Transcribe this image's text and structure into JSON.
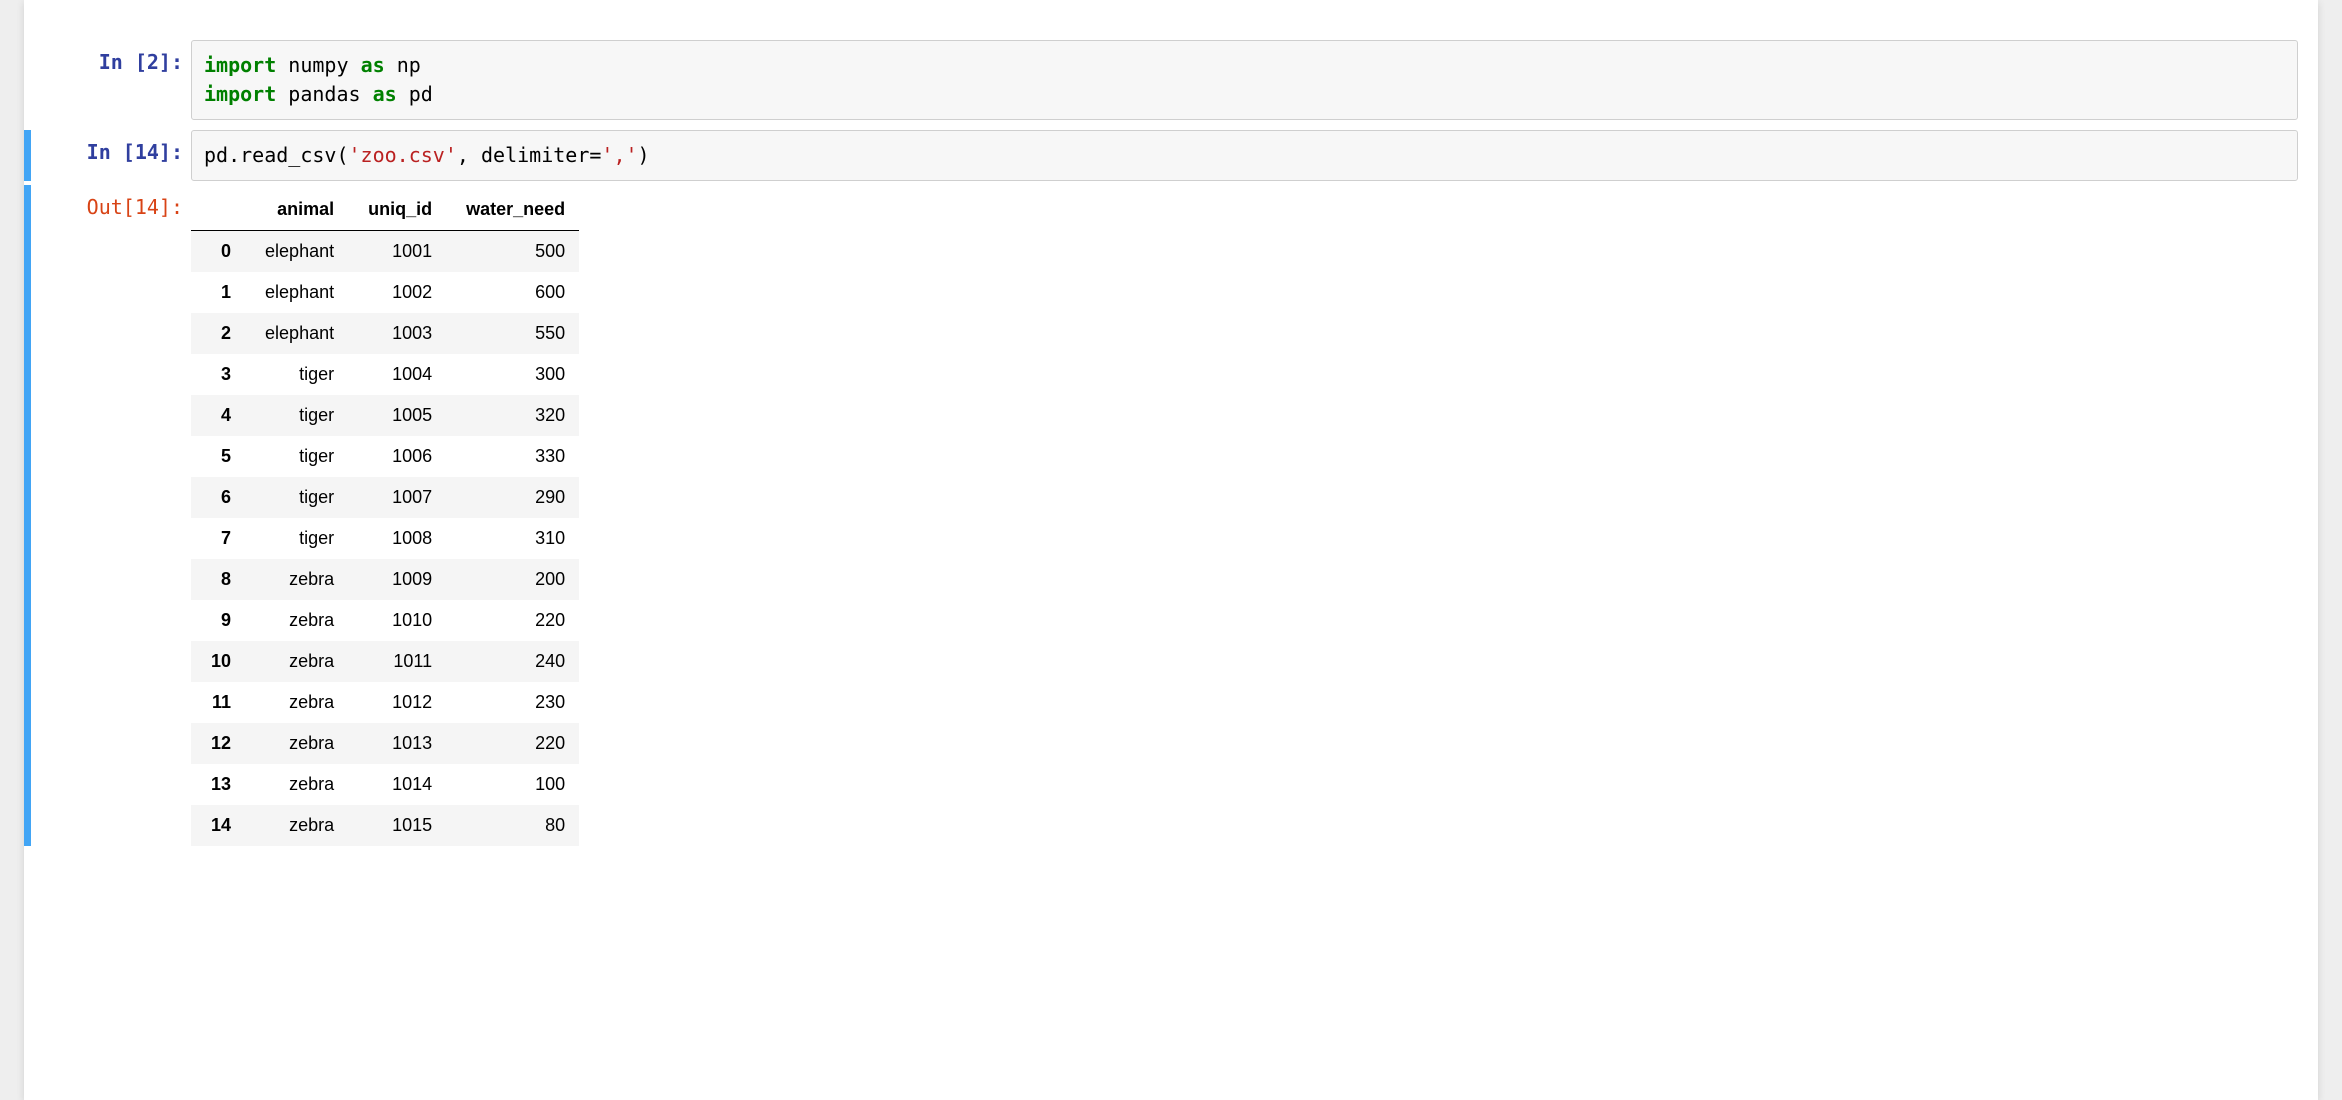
{
  "cells": {
    "c0": {
      "in_label": "In [2]:",
      "code_tokens": [
        {
          "t": "import",
          "c": "tok-kw"
        },
        {
          "t": " ",
          "c": ""
        },
        {
          "t": "numpy",
          "c": "tok-name"
        },
        {
          "t": " ",
          "c": ""
        },
        {
          "t": "as",
          "c": "tok-kw"
        },
        {
          "t": " ",
          "c": ""
        },
        {
          "t": "np",
          "c": "tok-name"
        },
        {
          "t": "\n",
          "c": ""
        },
        {
          "t": "import",
          "c": "tok-kw"
        },
        {
          "t": " ",
          "c": ""
        },
        {
          "t": "pandas",
          "c": "tok-name"
        },
        {
          "t": " ",
          "c": ""
        },
        {
          "t": "as",
          "c": "tok-kw"
        },
        {
          "t": " ",
          "c": ""
        },
        {
          "t": "pd",
          "c": "tok-name"
        }
      ]
    },
    "c1": {
      "in_label": "In [14]:",
      "out_label": "Out[14]:",
      "code_tokens": [
        {
          "t": "pd",
          "c": "tok-name"
        },
        {
          "t": ".",
          "c": "tok-punc"
        },
        {
          "t": "read_csv",
          "c": "tok-name"
        },
        {
          "t": "(",
          "c": "tok-punc"
        },
        {
          "t": "'zoo.csv'",
          "c": "tok-str"
        },
        {
          "t": ",",
          "c": "tok-punc"
        },
        {
          "t": " ",
          "c": ""
        },
        {
          "t": "delimiter",
          "c": "tok-name"
        },
        {
          "t": "=",
          "c": "tok-punc"
        },
        {
          "t": "','",
          "c": "tok-str"
        },
        {
          "t": ")",
          "c": "tok-punc"
        }
      ],
      "dataframe": {
        "columns": [
          "animal",
          "uniq_id",
          "water_need"
        ],
        "rows": [
          {
            "idx": "0",
            "animal": "elephant",
            "uniq_id": "1001",
            "water_need": "500"
          },
          {
            "idx": "1",
            "animal": "elephant",
            "uniq_id": "1002",
            "water_need": "600"
          },
          {
            "idx": "2",
            "animal": "elephant",
            "uniq_id": "1003",
            "water_need": "550"
          },
          {
            "idx": "3",
            "animal": "tiger",
            "uniq_id": "1004",
            "water_need": "300"
          },
          {
            "idx": "4",
            "animal": "tiger",
            "uniq_id": "1005",
            "water_need": "320"
          },
          {
            "idx": "5",
            "animal": "tiger",
            "uniq_id": "1006",
            "water_need": "330"
          },
          {
            "idx": "6",
            "animal": "tiger",
            "uniq_id": "1007",
            "water_need": "290"
          },
          {
            "idx": "7",
            "animal": "tiger",
            "uniq_id": "1008",
            "water_need": "310"
          },
          {
            "idx": "8",
            "animal": "zebra",
            "uniq_id": "1009",
            "water_need": "200"
          },
          {
            "idx": "9",
            "animal": "zebra",
            "uniq_id": "1010",
            "water_need": "220"
          },
          {
            "idx": "10",
            "animal": "zebra",
            "uniq_id": "1011",
            "water_need": "240"
          },
          {
            "idx": "11",
            "animal": "zebra",
            "uniq_id": "1012",
            "water_need": "230"
          },
          {
            "idx": "12",
            "animal": "zebra",
            "uniq_id": "1013",
            "water_need": "220"
          },
          {
            "idx": "13",
            "animal": "zebra",
            "uniq_id": "1014",
            "water_need": "100"
          },
          {
            "idx": "14",
            "animal": "zebra",
            "uniq_id": "1015",
            "water_need": "80"
          }
        ]
      }
    }
  }
}
